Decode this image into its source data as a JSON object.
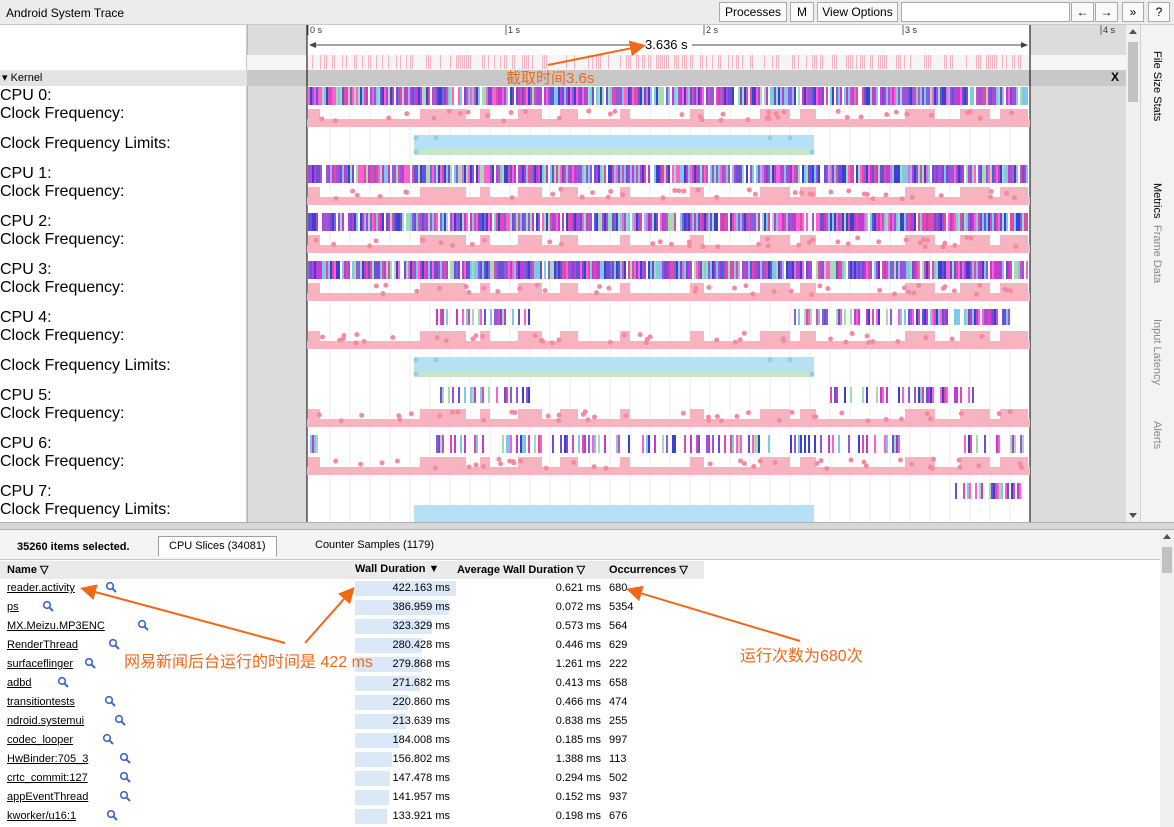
{
  "app_title": "Android System Trace",
  "toolbar": {
    "processes": "Processes",
    "m": "M",
    "view_options": "View Options",
    "search_placeholder": "",
    "back": "←",
    "forward": "→",
    "more": "»",
    "help": "?"
  },
  "ruler": {
    "ticks": [
      "0 s",
      "1 s",
      "2 s",
      "3 s",
      "4 s"
    ],
    "range_label": "3.636 s"
  },
  "kernel": {
    "label": "▾ Kernel",
    "close": "X"
  },
  "tracks": [
    {
      "label": "CPU 0:"
    },
    {
      "label": "Clock Frequency:"
    },
    {
      "label": "Clock Frequency Limits:"
    },
    {
      "label": "CPU 1:"
    },
    {
      "label": "Clock Frequency:"
    },
    {
      "label": "CPU 2:"
    },
    {
      "label": "Clock Frequency:"
    },
    {
      "label": "CPU 3:"
    },
    {
      "label": "Clock Frequency:"
    },
    {
      "label": "CPU 4:"
    },
    {
      "label": "Clock Frequency:"
    },
    {
      "label": "Clock Frequency Limits:"
    },
    {
      "label": "CPU 5:"
    },
    {
      "label": "Clock Frequency:"
    },
    {
      "label": "CPU 6:"
    },
    {
      "label": "Clock Frequency:"
    },
    {
      "label": "CPU 7:"
    },
    {
      "label": "Clock Frequency Limits:"
    }
  ],
  "side_panel": [
    "File Size Stats",
    "Metrics",
    "Frame Data",
    "Input Latency",
    "Alerts"
  ],
  "analysis": {
    "selected_count": "35260 items selected.",
    "tabs": [
      "CPU Slices (34081)",
      "Counter Samples (1179)"
    ],
    "columns": {
      "name": "Name ▽",
      "wall": "Wall Duration ▼",
      "avg": "Average Wall Duration ▽",
      "occ": "Occurrences ▽"
    },
    "rows": [
      {
        "name": "reader.activity",
        "wall": "422.163 ms",
        "avg": "0.621 ms",
        "occ": "680",
        "frac": 1.0
      },
      {
        "name": "ps",
        "wall": "386.959 ms",
        "avg": "0.072 ms",
        "occ": "5354",
        "frac": 0.917
      },
      {
        "name": "MX.Meizu.MP3ENC",
        "wall": "323.329 ms",
        "avg": "0.573 ms",
        "occ": "564",
        "frac": 0.766
      },
      {
        "name": "RenderThread",
        "wall": "280.428 ms",
        "avg": "0.446 ms",
        "occ": "629",
        "frac": 0.664
      },
      {
        "name": "surfaceflinger",
        "wall": "279.868 ms",
        "avg": "1.261 ms",
        "occ": "222",
        "frac": 0.663
      },
      {
        "name": "adbd",
        "wall": "271.682 ms",
        "avg": "0.413 ms",
        "occ": "658",
        "frac": 0.644
      },
      {
        "name": "transitiontests",
        "wall": "220.860 ms",
        "avg": "0.466 ms",
        "occ": "474",
        "frac": 0.523
      },
      {
        "name": "ndroid.systemui",
        "wall": "213.639 ms",
        "avg": "0.838 ms",
        "occ": "255",
        "frac": 0.506
      },
      {
        "name": "codec_looper",
        "wall": "184.008 ms",
        "avg": "0.185 ms",
        "occ": "997",
        "frac": 0.436
      },
      {
        "name": "HwBinder:705_3",
        "wall": "156.802 ms",
        "avg": "1.388 ms",
        "occ": "113",
        "frac": 0.371
      },
      {
        "name": "crtc_commit:127",
        "wall": "147.478 ms",
        "avg": "0.294 ms",
        "occ": "502",
        "frac": 0.349
      },
      {
        "name": "appEventThread",
        "wall": "141.957 ms",
        "avg": "0.152 ms",
        "occ": "937",
        "frac": 0.336
      },
      {
        "name": "kworker/u16:1",
        "wall": "133.921 ms",
        "avg": "0.198 ms",
        "occ": "676",
        "frac": 0.317
      }
    ]
  },
  "annotations": {
    "top": "截取时间3.6s",
    "name": "网易新闻后台运行的时间是 422 ms",
    "occ": "运行次数为680次",
    "color": "#f06818"
  },
  "colors": {
    "freq_pink": "#f7b3c0",
    "limit_blue": "#b6e0f5",
    "limit_green": "#c5e6c7"
  }
}
